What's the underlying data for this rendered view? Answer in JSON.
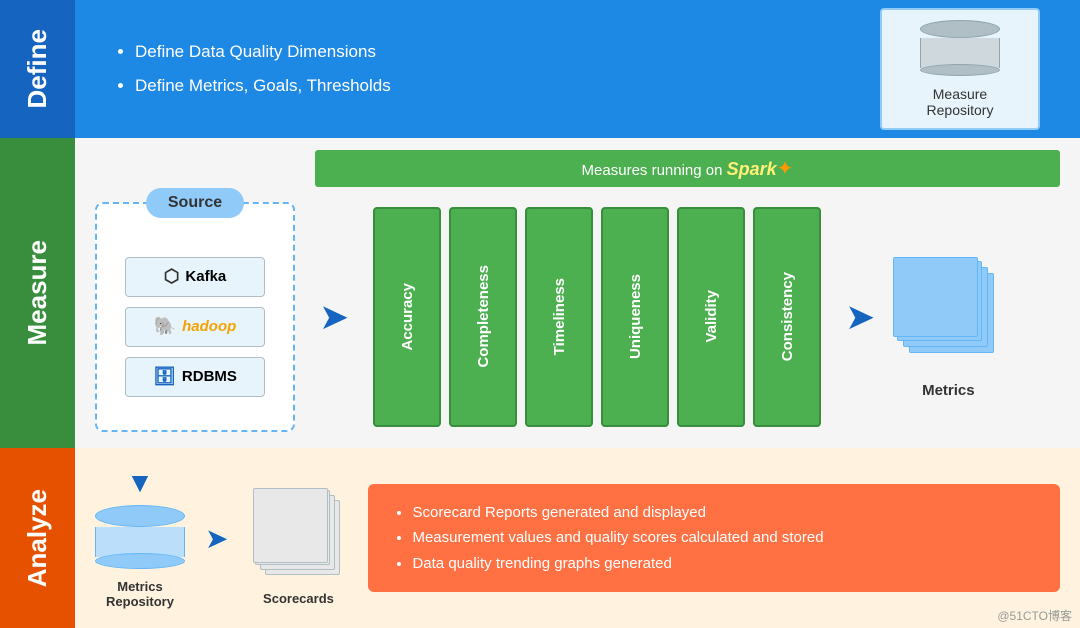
{
  "define": {
    "label": "Define",
    "bullet1": "Define Data Quality Dimensions",
    "bullet2": "Define Metrics, Goals, Thresholds",
    "measure_repo": {
      "label1": "Measure",
      "label2": "Repository"
    }
  },
  "measure": {
    "label": "Measure",
    "spark_banner": "Measures running on",
    "spark_word": "Spark",
    "source_label": "Source",
    "sources": [
      {
        "name": "Kafka",
        "icon": "⬡"
      },
      {
        "name": "Hadoop",
        "icon": "🐘"
      },
      {
        "name": "RDBMS",
        "icon": "🗄"
      }
    ],
    "bars": [
      "Accuracy",
      "Completeness",
      "Timeliness",
      "Uniqueness",
      "Validity",
      "Consistency"
    ],
    "metrics_label": "Metrics"
  },
  "analyze": {
    "label": "Analyze",
    "metrics_repo_label1": "Metrics",
    "metrics_repo_label2": "Repository",
    "scorecards_label": "Scorecards",
    "info_bullets": [
      "Scorecard Reports generated and displayed",
      "Measurement values and quality scores calculated and stored",
      "Data quality trending graphs generated"
    ]
  },
  "watermark": "@51CTO博客"
}
